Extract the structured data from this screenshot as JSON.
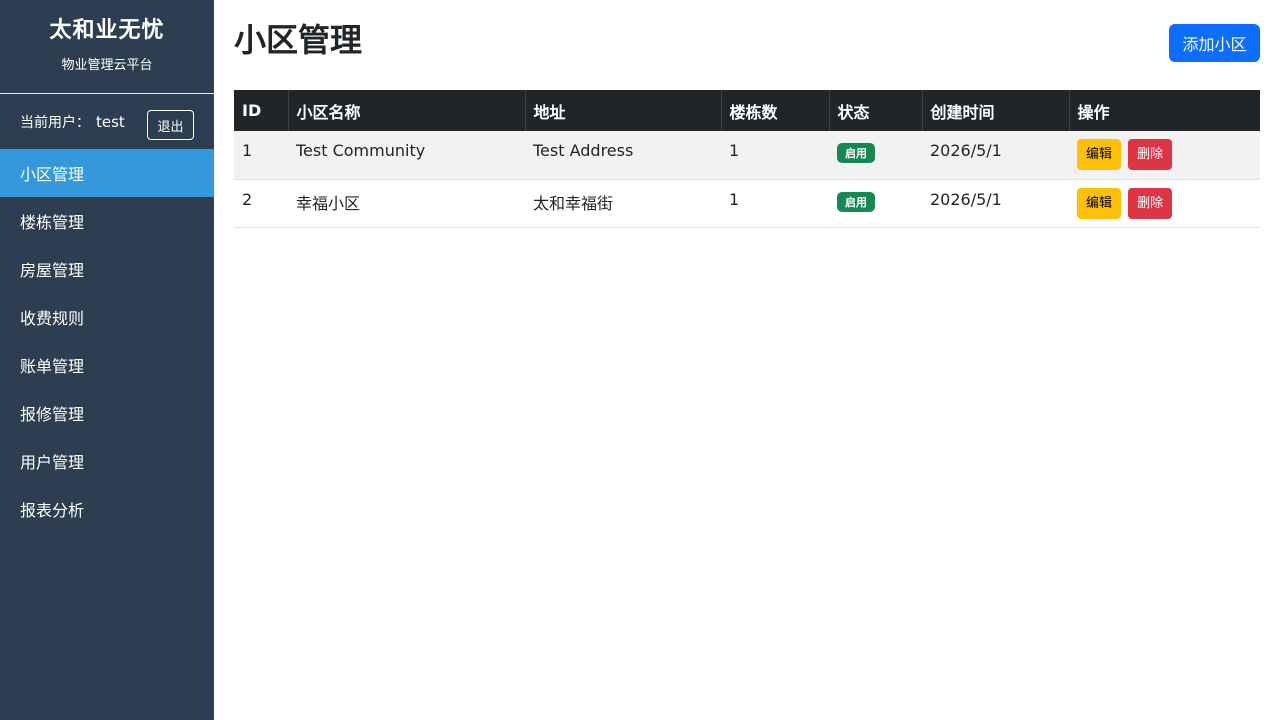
{
  "sidebar": {
    "brand_title": "太和业无忧",
    "brand_subtitle": "物业管理云平台",
    "user_label": "当前用户：",
    "user_name": "test",
    "logout_label": "退出",
    "items": [
      {
        "label": "小区管理",
        "active": true
      },
      {
        "label": "楼栋管理"
      },
      {
        "label": "房屋管理"
      },
      {
        "label": "收费规则"
      },
      {
        "label": "账单管理"
      },
      {
        "label": "报修管理"
      },
      {
        "label": "用户管理"
      },
      {
        "label": "报表分析"
      }
    ]
  },
  "main": {
    "title": "小区管理",
    "add_label": "添加小区",
    "table": {
      "columns": [
        "ID",
        "小区名称",
        "地址",
        "楼栋数",
        "状态",
        "创建时间",
        "操作"
      ],
      "rows": [
        {
          "id": "1",
          "name": "Test Community",
          "address": "Test Address",
          "buildings": "1",
          "status": "启用",
          "created": "2026/5/1",
          "edit": "编辑",
          "delete": "删除"
        },
        {
          "id": "2",
          "name": "幸福小区",
          "address": "太和幸福街",
          "buildings": "1",
          "status": "启用",
          "created": "2026/5/1",
          "edit": "编辑",
          "delete": "删除"
        }
      ]
    }
  },
  "colors": {
    "sidebar_bg": "#2c3e50",
    "active_item": "#3498db",
    "primary": "#0d6efd",
    "success": "#198754",
    "warning": "#ffc107",
    "danger": "#dc3545",
    "table_header": "#212529"
  }
}
